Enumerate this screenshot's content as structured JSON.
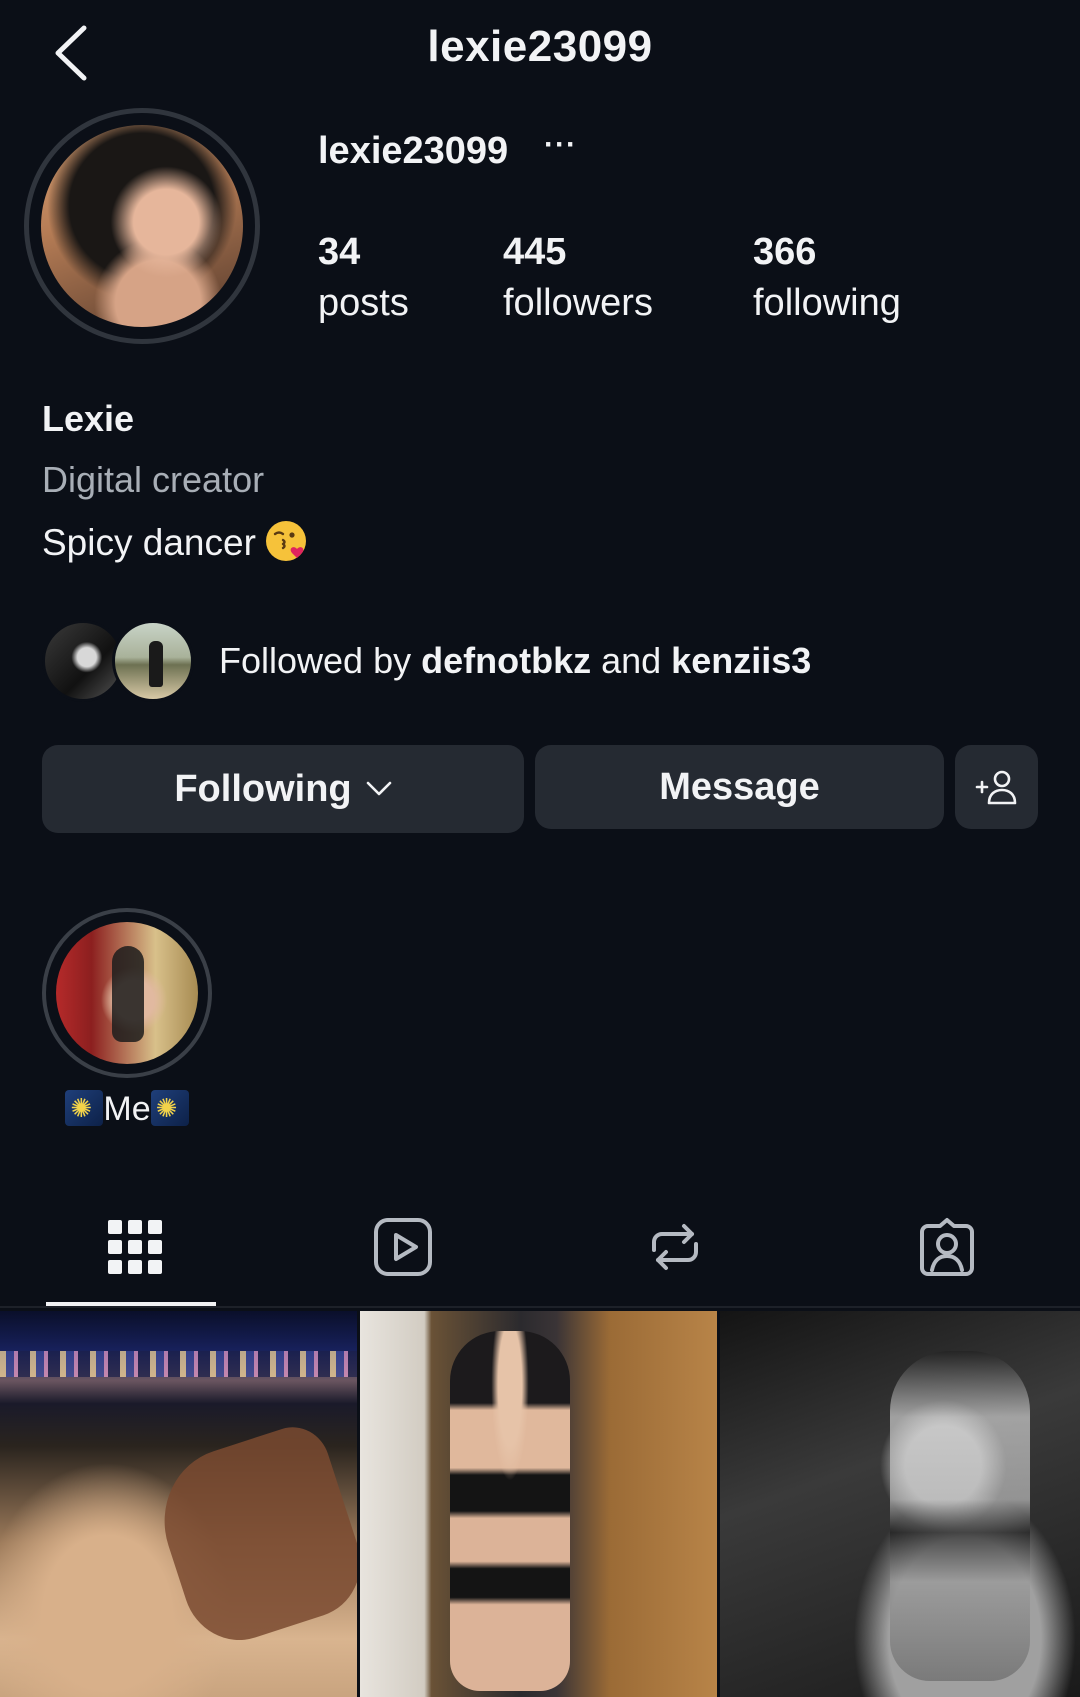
{
  "header": {
    "title": "lexie23099"
  },
  "profile": {
    "username": "lexie23099",
    "more": "···",
    "stats": [
      {
        "count": "34",
        "label": "posts"
      },
      {
        "count": "445",
        "label": "followers"
      },
      {
        "count": "366",
        "label": "following"
      }
    ],
    "display_name": "Lexie",
    "category": "Digital creator",
    "bio": "Spicy dancer"
  },
  "followed_by": {
    "prefix": "Followed by ",
    "user1": "defnotbkz",
    "joiner": " and ",
    "user2": "kenziis3"
  },
  "actions": {
    "following_label": "Following",
    "message_label": "Message"
  },
  "highlights": [
    {
      "label": "Me"
    }
  ],
  "tabs": {
    "selected": "grid",
    "items": [
      "grid-icon",
      "reels-icon",
      "reposts-icon",
      "tagged-icon"
    ]
  },
  "posts_visible": 3
}
